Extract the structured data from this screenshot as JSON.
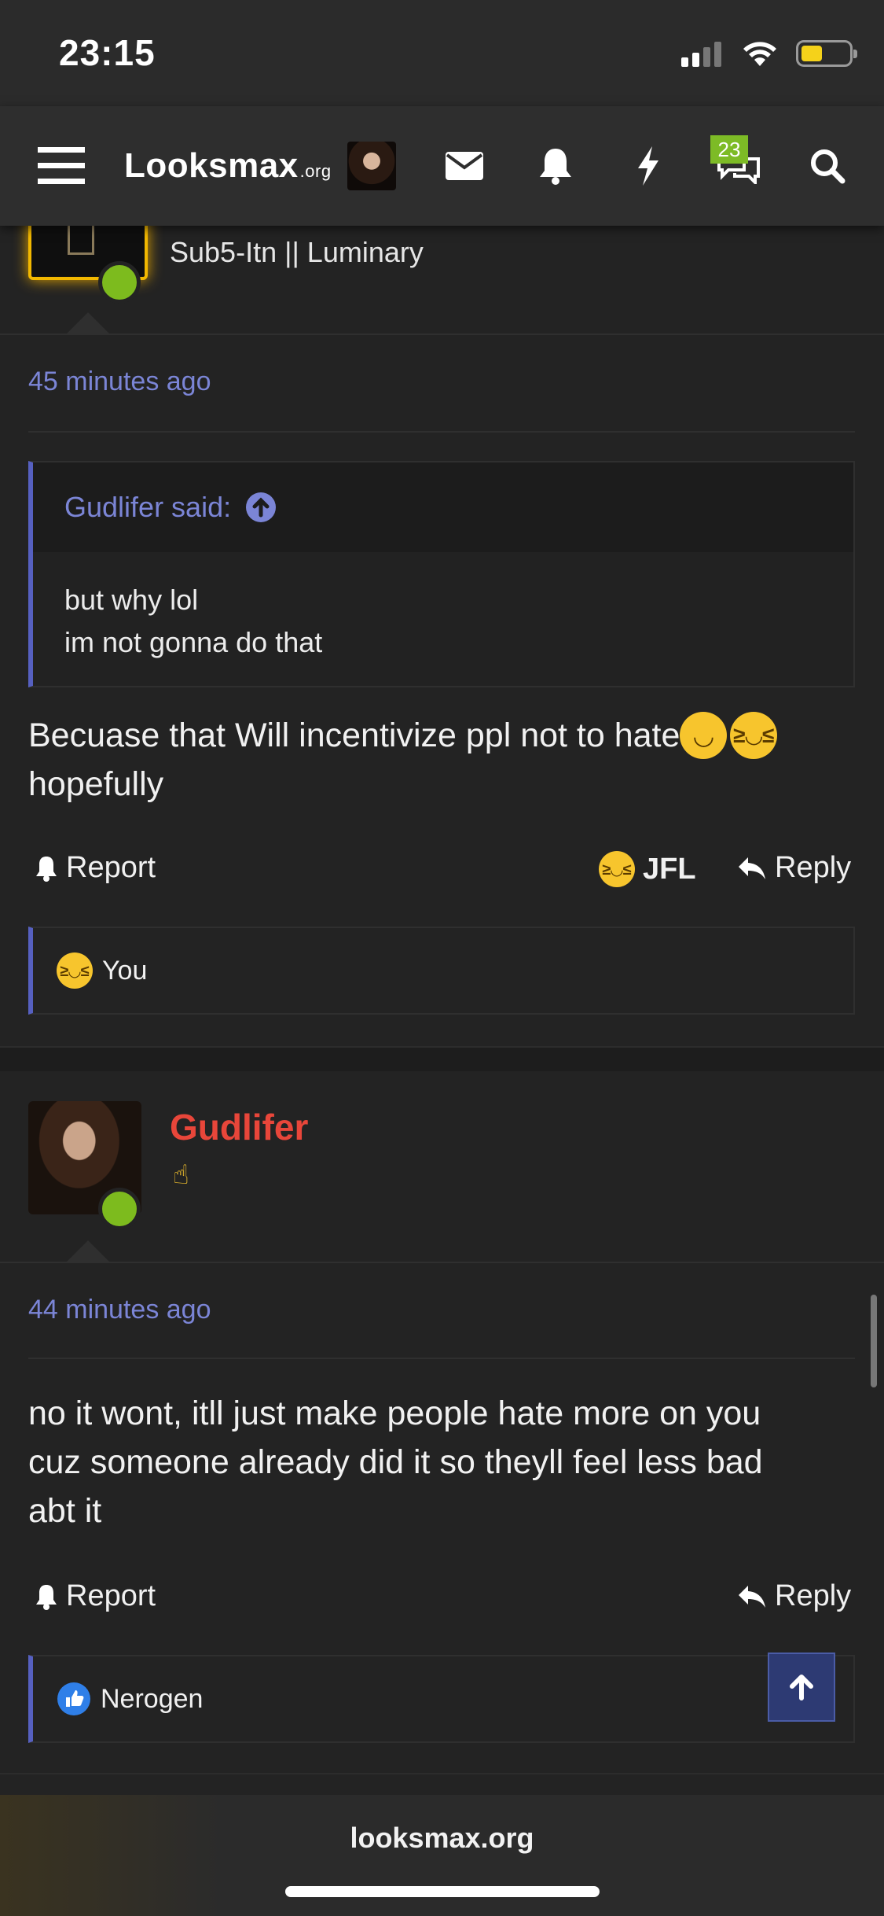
{
  "status_bar": {
    "time": "23:15",
    "battery_color": "#f5d21a"
  },
  "nav": {
    "menu_icon": "hamburger-icon",
    "logo_main": "Looksmax",
    "logo_suffix": ".org",
    "icons": [
      "envelope-icon",
      "bell-icon",
      "lightning-icon",
      "chat-bubbles-icon",
      "search-icon"
    ],
    "chat_badge": "23",
    "badge_color": "#7dbb26"
  },
  "post1": {
    "user_title": "Sub5-Itn || Luminary",
    "time": "45 minutes ago",
    "quote": {
      "author_line": "Gudlifer said:",
      "lines": [
        "but why lol",
        "im not gonna do that"
      ]
    },
    "text_line1": "Becuase that Will incentivize ppl not to hate",
    "text_line2": "hopefully",
    "report_label": "Report",
    "reaction_label": "JFL",
    "reply_label": "Reply",
    "reactions_by": "You"
  },
  "post2": {
    "username": "Gudlifer",
    "username_color": "#e8463a",
    "time": "44 minutes ago",
    "text_lines": [
      "no it wont, itll just make people hate more on you",
      "cuz someone already did it so theyll feel less bad",
      "abt it"
    ],
    "report_label": "Report",
    "reply_label": "Reply",
    "reactions_by": "Nerogen"
  },
  "browser": {
    "url": "looksmax.org"
  },
  "accent_color": "#7b85d6"
}
